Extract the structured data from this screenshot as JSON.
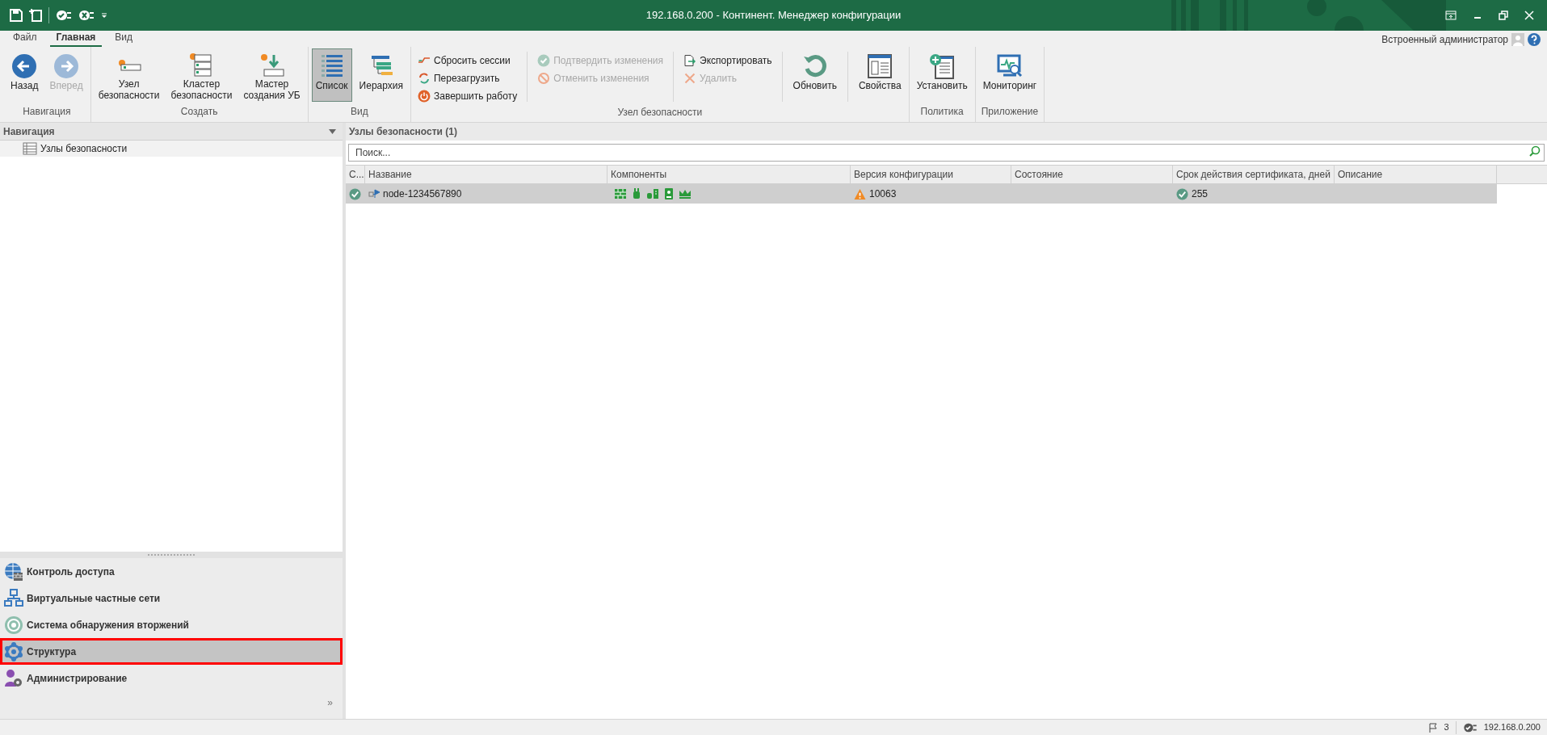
{
  "window": {
    "title": "192.168.0.200 - Континент. Менеджер конфигурации"
  },
  "ribbon": {
    "tabs": [
      {
        "label": "Файл",
        "selected": false
      },
      {
        "label": "Главная",
        "selected": true
      },
      {
        "label": "Вид",
        "selected": false
      }
    ],
    "user": "Встроенный администратор",
    "groups": [
      {
        "label": "Навигация",
        "items": [
          {
            "kind": "large",
            "label": "Назад",
            "disabled": false
          },
          {
            "kind": "large",
            "label": "Вперед",
            "disabled": true
          }
        ]
      },
      {
        "label": "Создать",
        "items": [
          {
            "kind": "large",
            "label": "Узел\nбезопасности",
            "disabled": false
          },
          {
            "kind": "large",
            "label": "Кластер\nбезопасности",
            "disabled": false
          },
          {
            "kind": "large",
            "label": "Мастер\nсоздания УБ",
            "disabled": false
          }
        ]
      },
      {
        "label": "Вид",
        "items": [
          {
            "kind": "large",
            "label": "Список",
            "disabled": false,
            "selected": true
          },
          {
            "kind": "large",
            "label": "Иерархия",
            "disabled": false,
            "selected": false
          }
        ]
      },
      {
        "label": "Узел безопасности",
        "items": [
          {
            "kind": "small",
            "label": "Сбросить сессии",
            "disabled": false
          },
          {
            "kind": "small",
            "label": "Перезагрузить",
            "disabled": false
          },
          {
            "kind": "small",
            "label": "Завершить работу",
            "disabled": false
          },
          {
            "kind": "separator"
          },
          {
            "kind": "small",
            "label": "Подтвердить изменения",
            "disabled": true
          },
          {
            "kind": "small",
            "label": "Отменить изменения",
            "disabled": true
          },
          {
            "kind": "separator"
          },
          {
            "kind": "small",
            "label": "Экспортировать",
            "disabled": false
          },
          {
            "kind": "small",
            "label": "Удалить",
            "disabled": true
          },
          {
            "kind": "separator"
          },
          {
            "kind": "large",
            "label": "Обновить",
            "disabled": false
          },
          {
            "kind": "separator"
          },
          {
            "kind": "large",
            "label": "Свойства",
            "disabled": false
          }
        ]
      },
      {
        "label": "Политика",
        "items": [
          {
            "kind": "large",
            "label": "Установить",
            "disabled": false
          }
        ]
      },
      {
        "label": "Приложение",
        "items": [
          {
            "kind": "large",
            "label": "Мониторинг",
            "disabled": false
          }
        ]
      }
    ]
  },
  "navigation": {
    "title": "Навигация",
    "tree": [
      {
        "label": "Узлы безопасности"
      }
    ],
    "modules": [
      {
        "label": "Контроль доступа",
        "selected": false,
        "marked": false
      },
      {
        "label": "Виртуальные частные сети",
        "selected": false,
        "marked": false
      },
      {
        "label": "Система обнаружения вторжений",
        "selected": false,
        "marked": false
      },
      {
        "label": "Структура",
        "selected": true,
        "marked": true
      },
      {
        "label": "Администрирование",
        "selected": false,
        "marked": false
      }
    ],
    "more": "»"
  },
  "content": {
    "title": "Узлы безопасности (1)",
    "search": {
      "placeholder": "Поиск..."
    },
    "columns": [
      "С...",
      "Название",
      "Компоненты",
      "Версия конфигурации",
      "Состояние",
      "Срок действия сертификата, дней",
      "Описание"
    ],
    "rows": [
      {
        "selected": true,
        "ok": true,
        "name": "node-1234567890",
        "version": "10063",
        "version_warning": true,
        "cert_days": "255",
        "cert_ok": true
      }
    ]
  },
  "status_bar": {
    "flags": "3",
    "connection": "192.168.0.200"
  }
}
